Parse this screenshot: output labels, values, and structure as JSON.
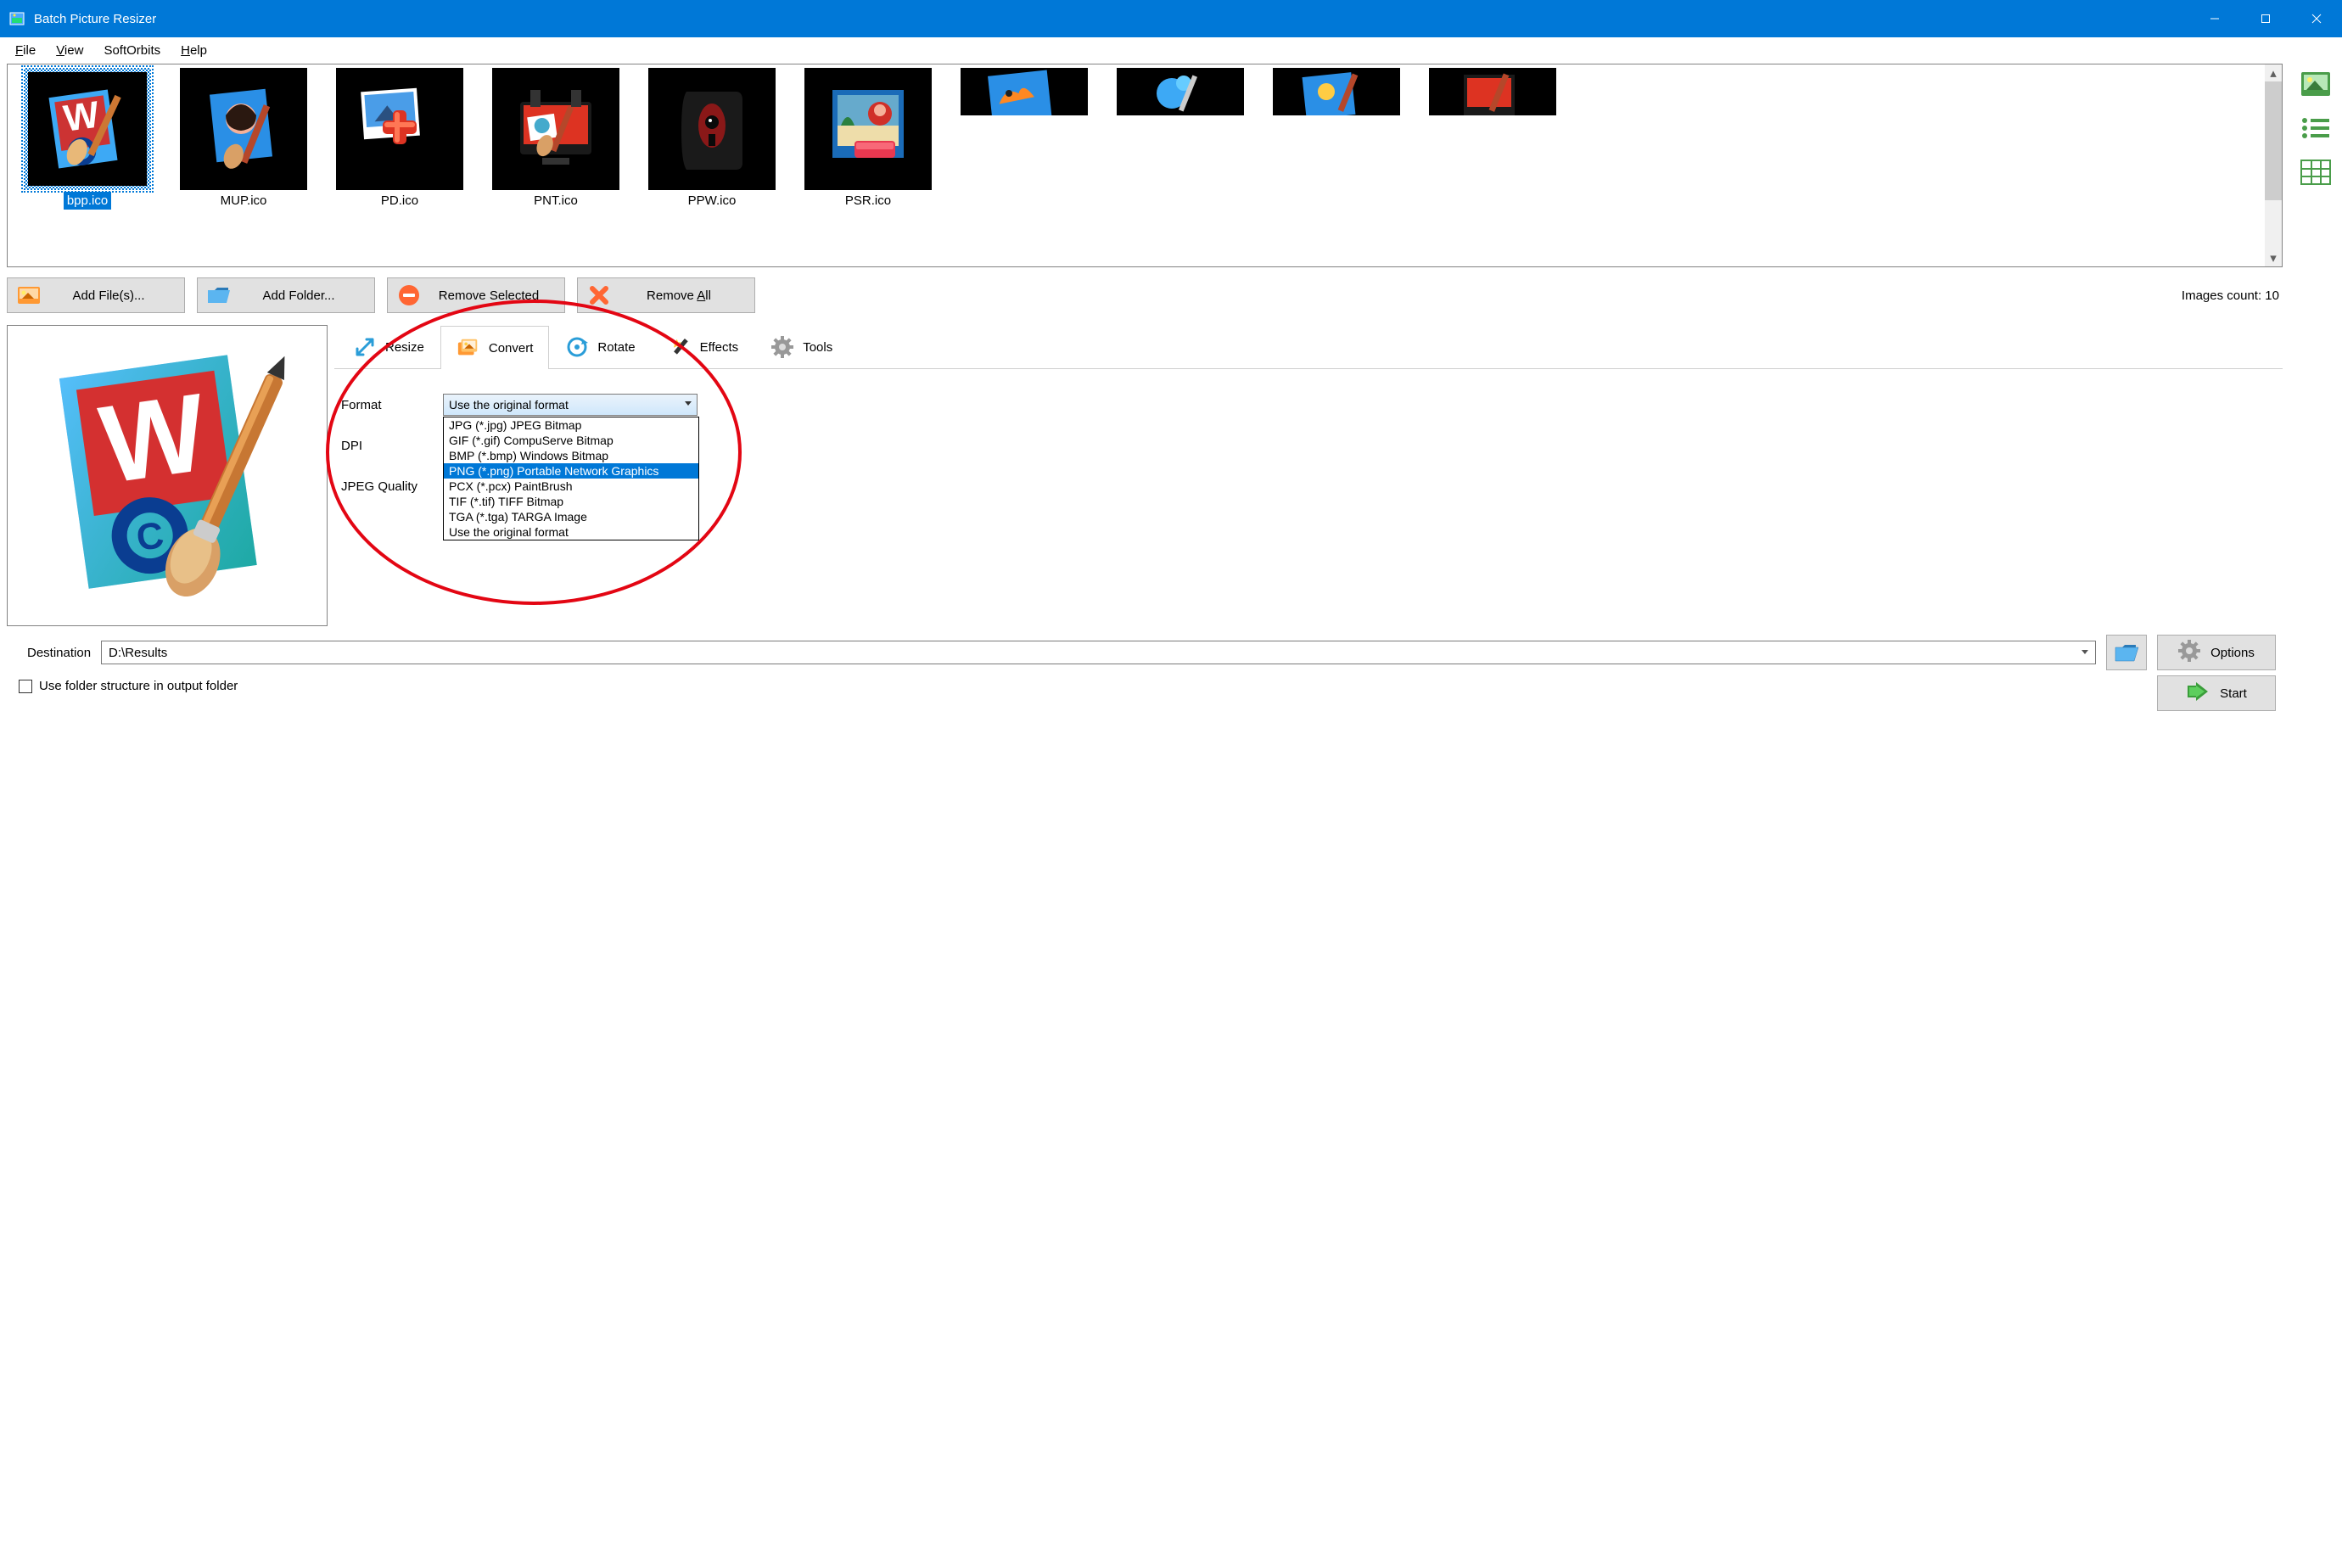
{
  "titlebar": {
    "title": "Batch Picture Resizer"
  },
  "menubar": {
    "file": "File",
    "view": "View",
    "softorbits": "SoftOrbits",
    "help": "Help"
  },
  "thumbnails": {
    "row1": [
      {
        "label": "bpp.ico"
      },
      {
        "label": "MUP.ico"
      },
      {
        "label": "PD.ico"
      },
      {
        "label": "PNT.ico"
      },
      {
        "label": "PPW.ico"
      },
      {
        "label": "PSR.ico"
      }
    ]
  },
  "actions": {
    "add_files": "Add File(s)...",
    "add_folder": "Add Folder...",
    "remove_selected": "Remove Selected",
    "remove_all": "Remove All",
    "images_count": "Images count: 10"
  },
  "tabs": {
    "resize": "Resize",
    "convert": "Convert",
    "rotate": "Rotate",
    "effects": "Effects",
    "tools": "Tools"
  },
  "convert_panel": {
    "format_label": "Format",
    "format_value": "Use the original format",
    "dpi_label": "DPI",
    "jpeg_label": "JPEG Quality",
    "options": [
      "JPG (*.jpg) JPEG Bitmap",
      "GIF (*.gif) CompuServe Bitmap",
      "BMP (*.bmp) Windows Bitmap",
      "PNG (*.png) Portable Network Graphics",
      "PCX (*.pcx) PaintBrush",
      "TIF (*.tif) TIFF Bitmap",
      "TGA (*.tga) TARGA Image",
      "Use the original format"
    ]
  },
  "destination": {
    "label": "Destination",
    "value": "D:\\Results",
    "options": "Options",
    "use_folder_structure": "Use folder structure in output folder",
    "start": "Start"
  }
}
